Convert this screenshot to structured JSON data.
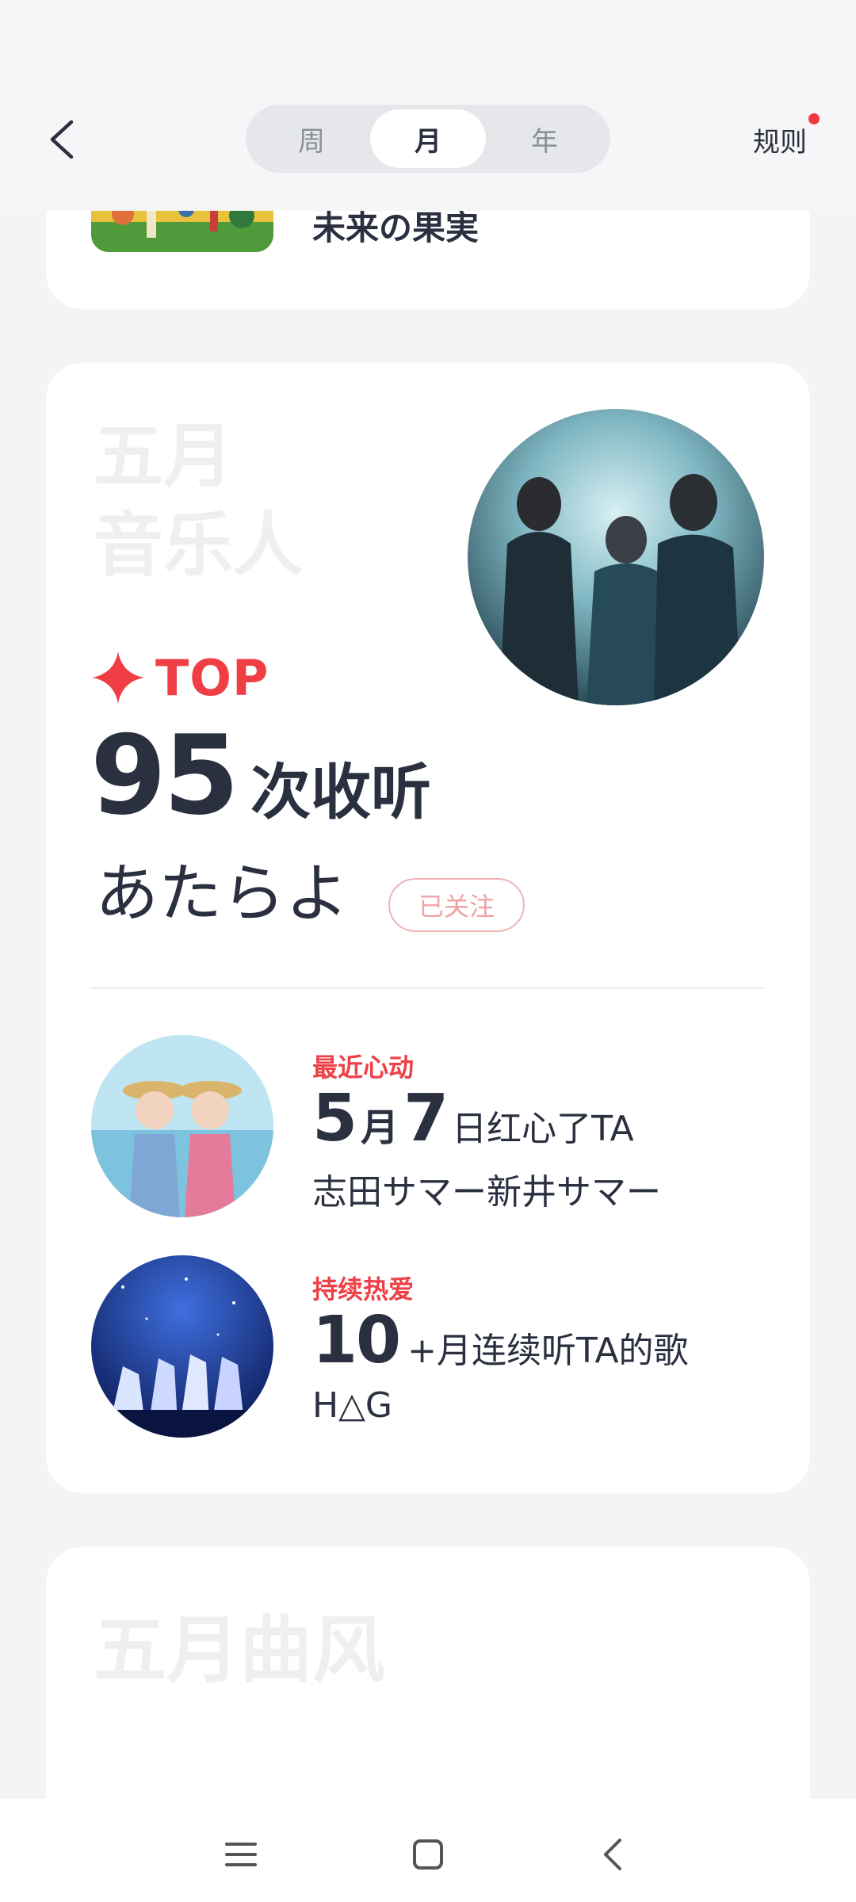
{
  "header": {
    "tabs": [
      {
        "label": "周",
        "selected": false
      },
      {
        "label": "月",
        "selected": true
      },
      {
        "label": "年",
        "selected": false
      }
    ],
    "rules_label": "规则",
    "rules_has_badge": true
  },
  "previous_card": {
    "title": "未来の果実"
  },
  "artist_card": {
    "watermark_line1": "五月",
    "watermark_line2": "音乐人",
    "top_label": "TOP",
    "play_count": "95",
    "play_count_label": "次收听",
    "artist_name": "あたらよ",
    "follow_label": "已关注",
    "stats": [
      {
        "tag": "最近心动",
        "value_month": "5",
        "value_month_unit": "月",
        "value_day": "7",
        "value_rest": "日红心了TA",
        "artist": "志田サマー新井サマー"
      },
      {
        "tag": "持续热爱",
        "value_big": "10",
        "value_rest": "+月连续听TA的歌",
        "artist": "H△G"
      }
    ]
  },
  "next_card": {
    "watermark": "五月曲风"
  },
  "colors": {
    "accent": "#ef3f45",
    "text_primary": "#2b3040",
    "background": "#f4f4f6",
    "watermark": "#efeff1"
  },
  "icons": [
    "back-arrow-icon",
    "sparkle-star-icon",
    "menu-icon",
    "home-square-icon",
    "nav-back-icon"
  ]
}
